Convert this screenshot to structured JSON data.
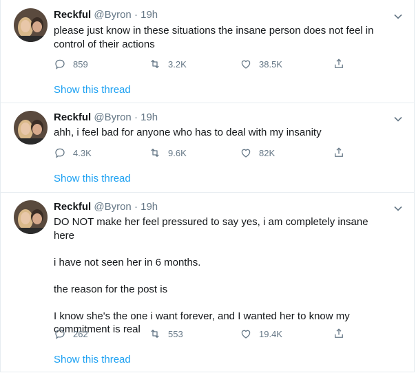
{
  "tweets": [
    {
      "name": "Reckful",
      "handle": "@Byron",
      "dot": "·",
      "time": "19h",
      "text": "please just know in these situations the insane person does not feel in\ncontrol of their actions",
      "replies": "859",
      "retweets": "3.2K",
      "likes": "38.5K",
      "thread_link": "Show this thread"
    },
    {
      "name": "Reckful",
      "handle": "@Byron",
      "dot": "·",
      "time": "19h",
      "text": "ahh, i feel bad for anyone who has to deal with my insanity",
      "replies": "4.3K",
      "retweets": "9.6K",
      "likes": "82K",
      "thread_link": "Show this thread"
    },
    {
      "name": "Reckful",
      "handle": "@Byron",
      "dot": "·",
      "time": "19h",
      "text": "DO NOT make her feel pressured to say yes, i am completely insane here\n\ni have not seen her in 6 months.\n\nthe reason for the post is\n\nI know she's the one i want forever, and I wanted her to know my\ncommitment is real",
      "replies": "262",
      "retweets": "553",
      "likes": "19.4K",
      "thread_link": "Show this thread"
    }
  ],
  "colors": {
    "link": "#1da1f2",
    "muted": "#657786",
    "text": "#14171a",
    "border": "#e6ecf0"
  },
  "icons": [
    "chevron-down-icon",
    "reply-icon",
    "retweet-icon",
    "like-icon",
    "share-icon"
  ]
}
